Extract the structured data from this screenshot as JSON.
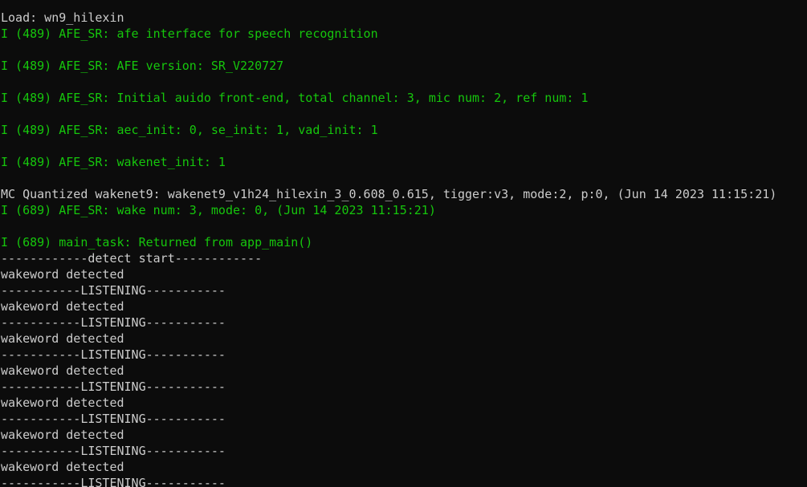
{
  "terminal": {
    "lines": [
      {
        "text": "",
        "color": "white"
      },
      {
        "text": "Load: wn9_hilexin",
        "color": "white"
      },
      {
        "text": "I (489) AFE_SR: afe interface for speech recognition",
        "color": "green"
      },
      {
        "text": "",
        "color": "white"
      },
      {
        "text": "I (489) AFE_SR: AFE version: SR_V220727",
        "color": "green"
      },
      {
        "text": "",
        "color": "white"
      },
      {
        "text": "I (489) AFE_SR: Initial auido front-end, total channel: 3, mic num: 2, ref num: 1",
        "color": "green"
      },
      {
        "text": "",
        "color": "white"
      },
      {
        "text": "I (489) AFE_SR: aec_init: 0, se_init: 1, vad_init: 1",
        "color": "green"
      },
      {
        "text": "",
        "color": "white"
      },
      {
        "text": "I (489) AFE_SR: wakenet_init: 1",
        "color": "green"
      },
      {
        "text": "",
        "color": "white"
      },
      {
        "text": "MC Quantized wakenet9: wakenet9_v1h24_hilexin_3_0.608_0.615, tigger:v3, mode:2, p:0, (Jun 14 2023 11:15:21)",
        "color": "white"
      },
      {
        "text": "I (689) AFE_SR: wake num: 3, mode: 0, (Jun 14 2023 11:15:21)",
        "color": "green"
      },
      {
        "text": "",
        "color": "white"
      },
      {
        "text": "I (689) main_task: Returned from app_main()",
        "color": "green"
      },
      {
        "text": "------------detect start------------",
        "color": "white"
      },
      {
        "text": "wakeword detected",
        "color": "white"
      },
      {
        "text": "-----------LISTENING-----------",
        "color": "white"
      },
      {
        "text": "wakeword detected",
        "color": "white"
      },
      {
        "text": "-----------LISTENING-----------",
        "color": "white"
      },
      {
        "text": "wakeword detected",
        "color": "white"
      },
      {
        "text": "-----------LISTENING-----------",
        "color": "white"
      },
      {
        "text": "wakeword detected",
        "color": "white"
      },
      {
        "text": "-----------LISTENING-----------",
        "color": "white"
      },
      {
        "text": "wakeword detected",
        "color": "white"
      },
      {
        "text": "-----------LISTENING-----------",
        "color": "white"
      },
      {
        "text": "wakeword detected",
        "color": "white"
      },
      {
        "text": "-----------LISTENING-----------",
        "color": "white"
      },
      {
        "text": "wakeword detected",
        "color": "white"
      },
      {
        "text": "-----------LISTENING-----------",
        "color": "white"
      }
    ],
    "colors": {
      "background": "#0c0c0c",
      "white": "#cccccc",
      "green": "#16c60c"
    }
  }
}
